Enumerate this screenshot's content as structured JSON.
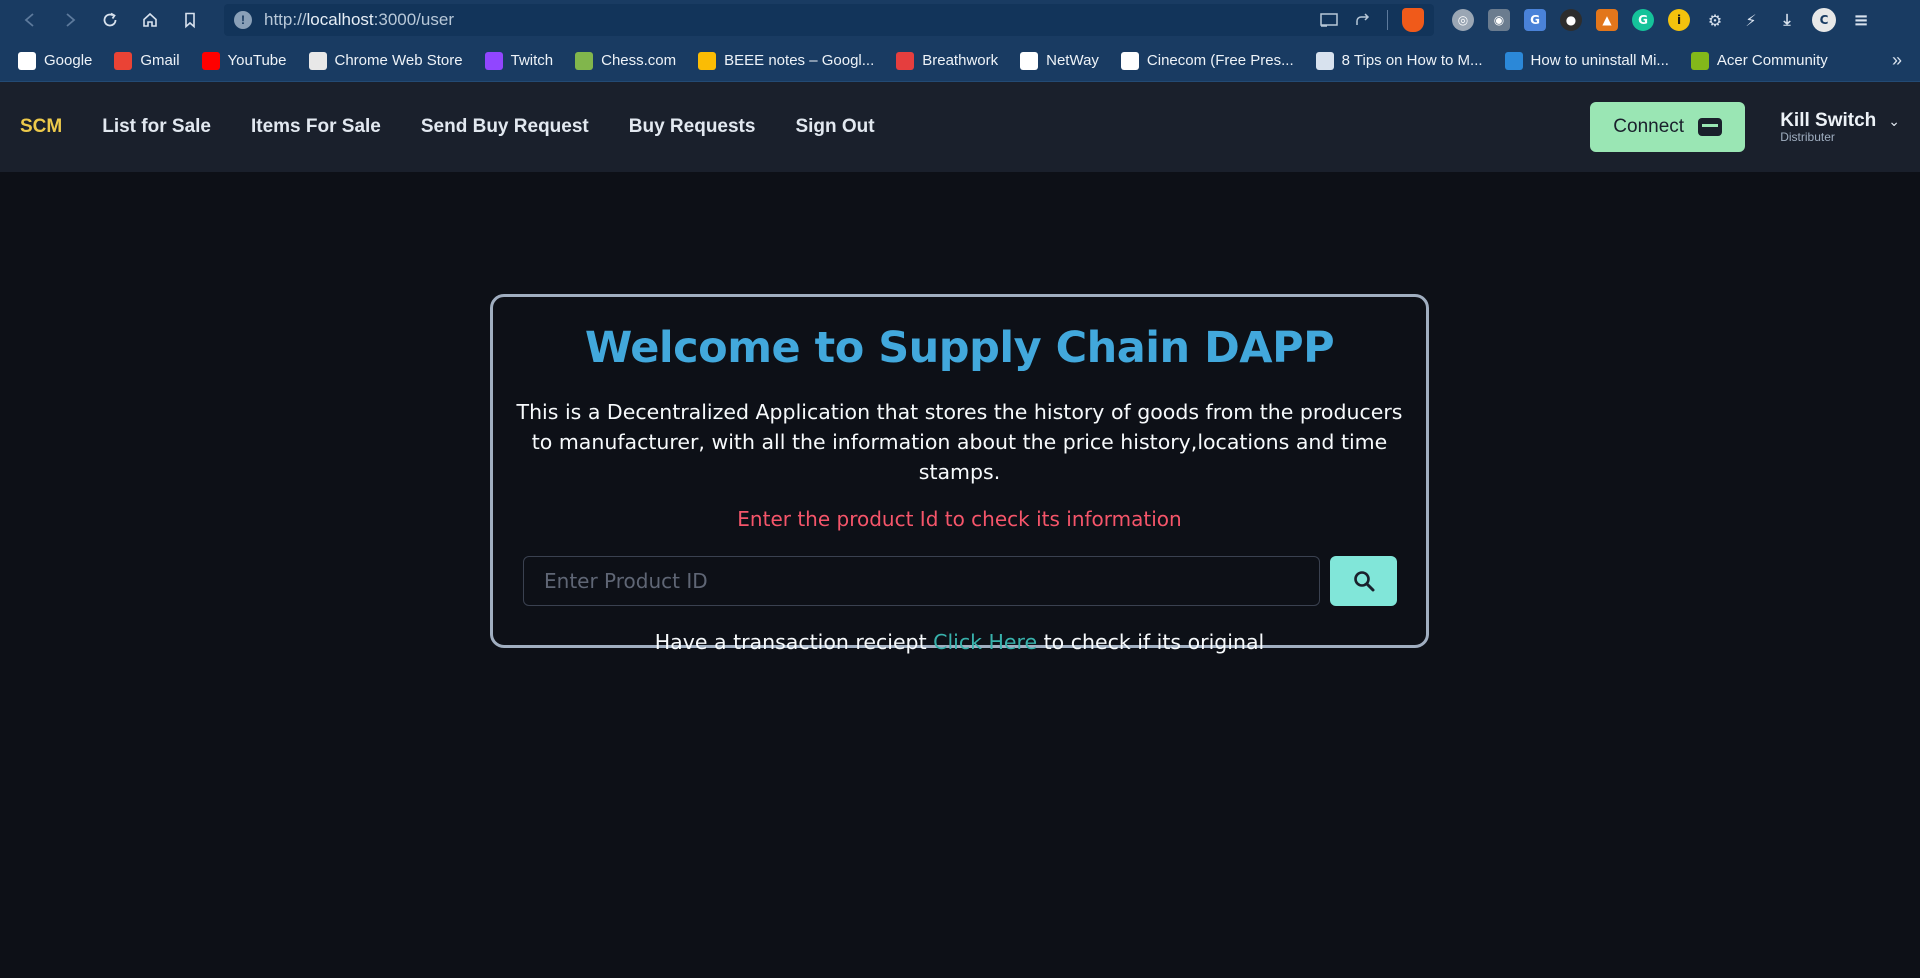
{
  "browser": {
    "url_prefix": "http://",
    "url_host": "localhost",
    "url_path": ":3000/user"
  },
  "bookmarks": [
    {
      "label": "Google",
      "icon": "globe-icon",
      "color": "#ffffff"
    },
    {
      "label": "Gmail",
      "icon": "gmail-icon",
      "color": "#ea4335"
    },
    {
      "label": "YouTube",
      "icon": "youtube-icon",
      "color": "#ff0000"
    },
    {
      "label": "Chrome Web Store",
      "icon": "chrome-web-store-icon",
      "color": "#e8e8e8"
    },
    {
      "label": "Twitch",
      "icon": "twitch-icon",
      "color": "#9146ff"
    },
    {
      "label": "Chess.com",
      "icon": "chess-pawn-icon",
      "color": "#81b64c"
    },
    {
      "label": "BEEE notes – Googl...",
      "icon": "google-drive-icon",
      "color": "#fbbc04"
    },
    {
      "label": "Breathwork",
      "icon": "breathwork-icon",
      "color": "#e53e3e"
    },
    {
      "label": "NetWay",
      "icon": "globe-icon",
      "color": "#ffffff"
    },
    {
      "label": "Cinecom (Free Pres...",
      "icon": "cinecom-icon",
      "color": "#ffffff"
    },
    {
      "label": "8 Tips on How to M...",
      "icon": "link-icon",
      "color": "#d8e2ee"
    },
    {
      "label": "How to uninstall Mi...",
      "icon": "windows-flag-icon",
      "color": "#2b88d8"
    },
    {
      "label": "Acer Community",
      "icon": "acer-icon",
      "color": "#83b81a"
    }
  ],
  "bookmarks_more": "»",
  "app": {
    "brand": "SCM",
    "nav_links": [
      "List for Sale",
      "Items For Sale",
      "Send Buy Request",
      "Buy Requests",
      "Sign Out"
    ],
    "connect_label": "Connect",
    "user_name": "Kill Switch",
    "user_role": "Distributer"
  },
  "card": {
    "title": "Welcome to Supply Chain DAPP",
    "description": "This is a Decentralized Application that stores the history of goods from the producers to manufacturer, with all the information about the price history,locations and time stamps.",
    "prompt": "Enter the product Id to check its information",
    "search_placeholder": "Enter Product ID",
    "receipt_before": "Have a transaction reciept ",
    "receipt_link": "Click Here",
    "receipt_after": " to check if its original"
  },
  "colors": {
    "brand": "#ecc94b",
    "title": "#42a8dc",
    "prompt": "#f5556a",
    "connect_bg": "#9ae6b4",
    "search_btn_bg": "#81e6d9",
    "link": "#38b2ac",
    "page_bg": "#0d1017",
    "navbar_bg": "#1a202c"
  }
}
